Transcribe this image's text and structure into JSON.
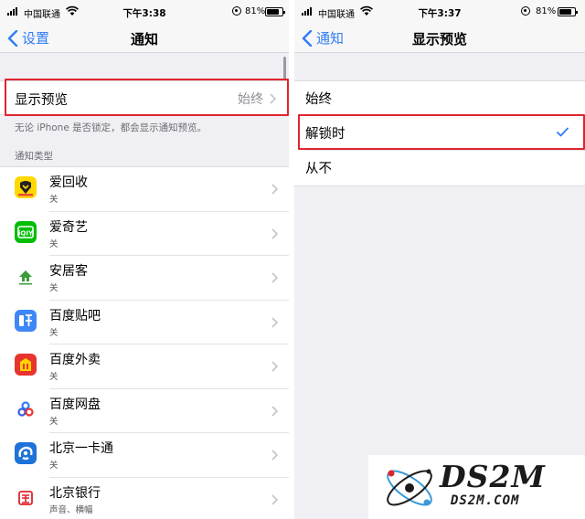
{
  "left_screen": {
    "status_bar": {
      "carrier": "中国联通",
      "time": "下午3:38",
      "battery": "81%",
      "battery_fraction": 0.81
    },
    "nav": {
      "back_label": "设置",
      "title": "通知"
    },
    "preview_row": {
      "label": "显示预览",
      "value": "始终"
    },
    "footnote": "无论 iPhone 是否锁定，都会显示通知预览。",
    "section_header": "通知类型",
    "apps": [
      {
        "name": "爱回收",
        "status": "关",
        "icon": "aihuishou-icon",
        "color": "#ffd800"
      },
      {
        "name": "爱奇艺",
        "status": "关",
        "icon": "iqiyi-icon",
        "color": "#00be06"
      },
      {
        "name": "安居客",
        "status": "关",
        "icon": "anjuke-icon",
        "color": "#ffffff"
      },
      {
        "name": "百度贴吧",
        "status": "关",
        "icon": "baidu-tieba-icon",
        "color": "#3e88f5"
      },
      {
        "name": "百度外卖",
        "status": "关",
        "icon": "baidu-waimai-icon",
        "color": "#e8342e"
      },
      {
        "name": "百度网盘",
        "status": "关",
        "icon": "baidu-wangpan-icon",
        "color": "#ffffff"
      },
      {
        "name": "北京一卡通",
        "status": "关",
        "icon": "beijing-yikatong-icon",
        "color": "#1e73d8"
      },
      {
        "name": "北京银行",
        "status": "声音、横幅",
        "icon": "beijing-bank-icon",
        "color": "#ffffff"
      }
    ]
  },
  "right_screen": {
    "status_bar": {
      "carrier": "中国联通",
      "time": "下午3:37",
      "battery": "81%",
      "battery_fraction": 0.81
    },
    "nav": {
      "back_label": "通知",
      "title": "显示预览"
    },
    "options": [
      {
        "label": "始终",
        "selected": false
      },
      {
        "label": "解锁时",
        "selected": true
      },
      {
        "label": "从不",
        "selected": false
      }
    ]
  },
  "colors": {
    "ios_blue": "#2f7cf6",
    "highlight_red": "#e0242c",
    "group_bg": "#efeff4"
  },
  "watermark": {
    "big": "DS2M",
    "small": "DS2M.COM"
  }
}
